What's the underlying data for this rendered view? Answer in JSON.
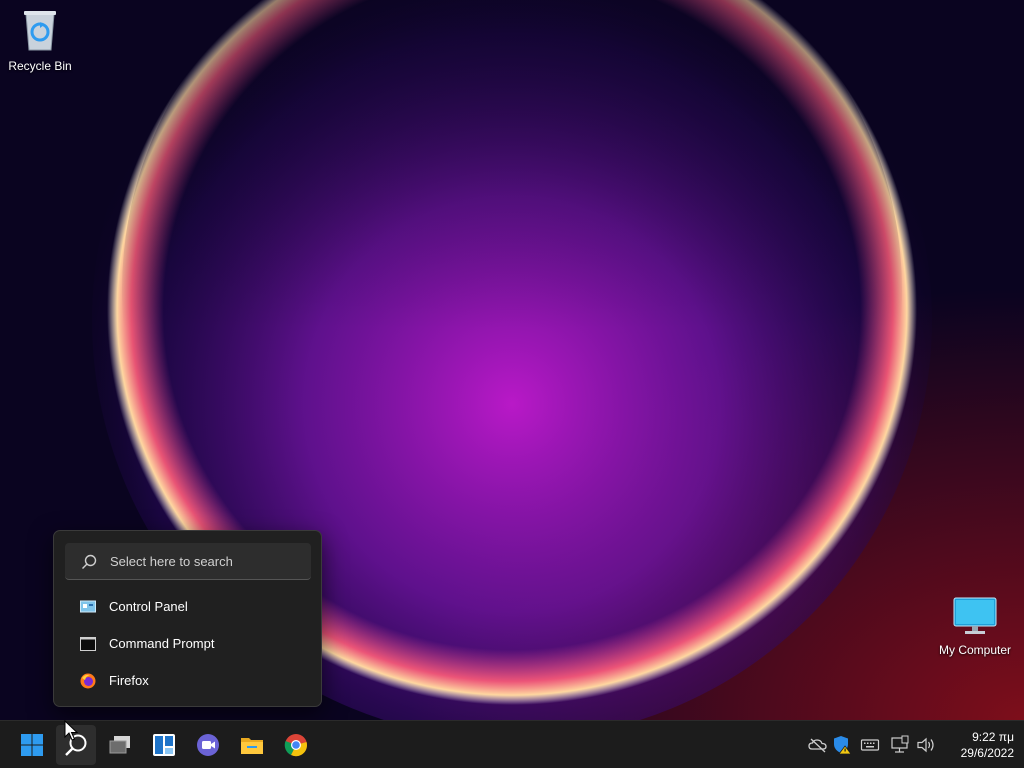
{
  "desktop": {
    "icons": [
      {
        "label": "Recycle Bin",
        "icon": "recycle-bin-icon"
      },
      {
        "label": "My Computer",
        "icon": "monitor-icon"
      }
    ]
  },
  "search_flyout": {
    "placeholder": "Select here to search",
    "results": [
      {
        "label": "Control Panel",
        "icon": "control-panel-icon"
      },
      {
        "label": "Command Prompt",
        "icon": "command-prompt-icon"
      },
      {
        "label": "Firefox",
        "icon": "firefox-icon"
      }
    ]
  },
  "taskbar": {
    "pinned": [
      {
        "name": "Start",
        "icon": "windows-logo-icon"
      },
      {
        "name": "Search",
        "icon": "search-icon",
        "active": true
      },
      {
        "name": "Task View",
        "icon": "task-view-icon"
      },
      {
        "name": "Widgets",
        "icon": "widgets-icon"
      },
      {
        "name": "Chat",
        "icon": "chat-camera-icon"
      },
      {
        "name": "File Explorer",
        "icon": "folder-icon"
      },
      {
        "name": "Google Chrome",
        "icon": "chrome-icon"
      }
    ],
    "tray": {
      "icons": [
        "onedrive-offline-icon",
        "windows-security-warning-icon",
        "keyboard-icon",
        "network-icon",
        "volume-icon"
      ],
      "time": "9:22 πμ",
      "date": "29/6/2022"
    }
  },
  "colors": {
    "taskbar_bg": "#1c1c1c",
    "flyout_bg": "#202020",
    "accent_blue": "#2e9bf0",
    "wallpaper_magenta": "#c21ad0",
    "wallpaper_dark": "#0a0420"
  }
}
